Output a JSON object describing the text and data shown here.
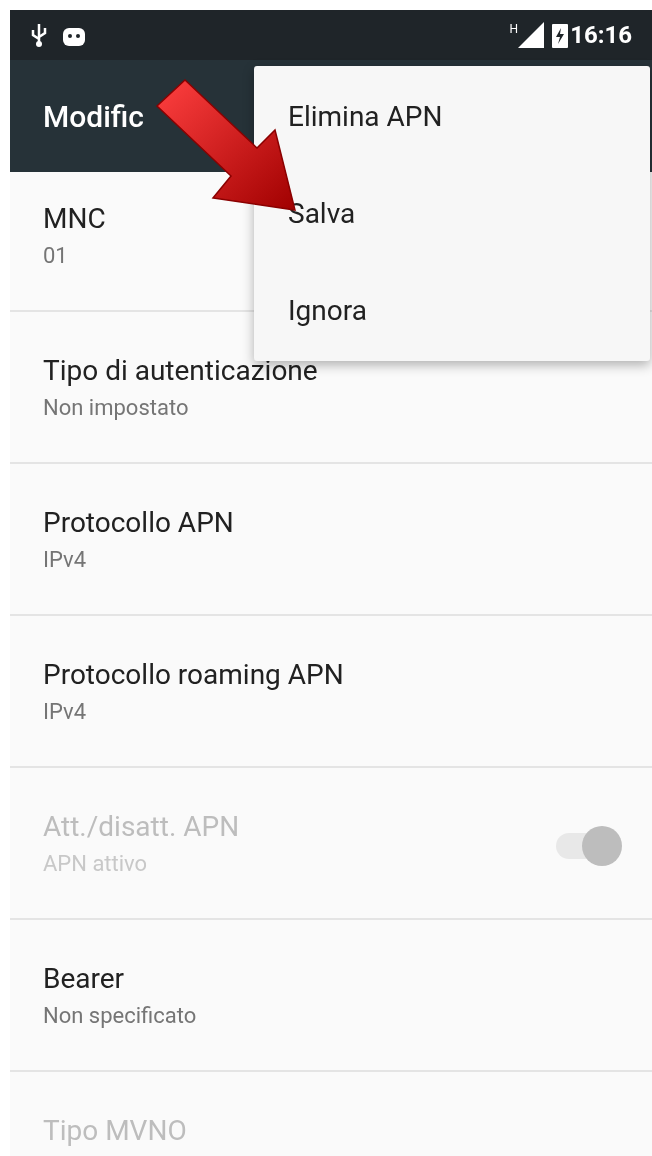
{
  "status_bar": {
    "time": "16:16",
    "network": "H"
  },
  "app_bar": {
    "title": "Modific"
  },
  "menu": {
    "items": [
      {
        "label": "Elimina APN"
      },
      {
        "label": "Salva"
      },
      {
        "label": "Ignora"
      }
    ]
  },
  "settings": [
    {
      "kind": "text",
      "title": "MNC",
      "summary": "01",
      "disabled": false
    },
    {
      "kind": "text",
      "title": "Tipo di autenticazione",
      "summary": "Non impostato",
      "disabled": false
    },
    {
      "kind": "text",
      "title": "Protocollo APN",
      "summary": "IPv4",
      "disabled": false
    },
    {
      "kind": "text",
      "title": "Protocollo roaming APN",
      "summary": "IPv4",
      "disabled": false
    },
    {
      "kind": "switch",
      "title": "Att./disatt. APN",
      "summary": "APN attivo",
      "disabled": true,
      "on": true
    },
    {
      "kind": "text",
      "title": "Bearer",
      "summary": "Non specificato",
      "disabled": false
    },
    {
      "kind": "text",
      "title": "Tipo MVNO",
      "disabled": true
    }
  ]
}
